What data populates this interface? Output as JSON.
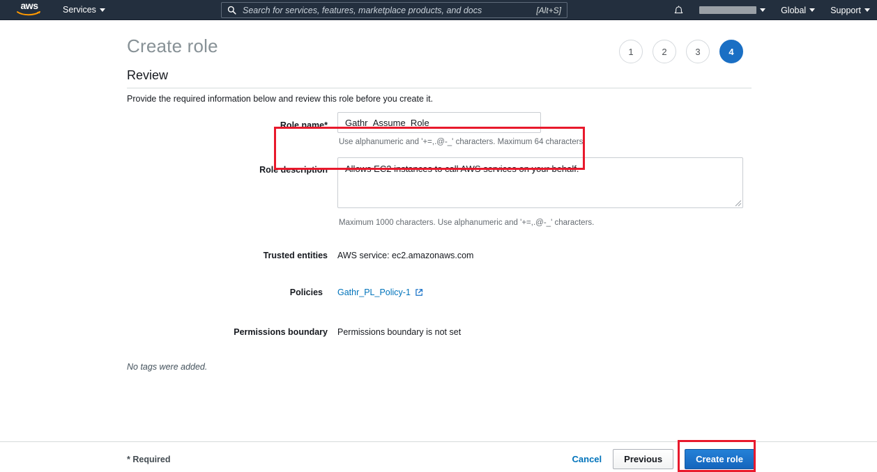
{
  "topnav": {
    "logo_alt": "aws",
    "services_label": "Services",
    "search": {
      "placeholder": "Search for services, features, marketplace products, and docs",
      "value": "",
      "shortcut": "[Alt+S]"
    },
    "account_label": "",
    "region_label": "Global",
    "support_label": "Support"
  },
  "page": {
    "title": "Create role",
    "section_title": "Review",
    "section_description": "Provide the required information below and review this role before you create it.",
    "steps": [
      {
        "label": "1",
        "active": false
      },
      {
        "label": "2",
        "active": false
      },
      {
        "label": "3",
        "active": false
      },
      {
        "label": "4",
        "active": true
      }
    ],
    "fields": {
      "role_name": {
        "label": "Role name*",
        "value": "Gathr_Assume_Role",
        "hint": "Use alphanumeric and '+=,.@-_' characters. Maximum 64 characters."
      },
      "role_description": {
        "label": "Role description",
        "value": "Allows EC2 instances to call AWS services on your behalf.",
        "hint": "Maximum 1000 characters. Use alphanumeric and '+=,.@-_' characters."
      },
      "trusted_entities": {
        "label": "Trusted entities",
        "value": "AWS service: ec2.amazonaws.com"
      },
      "policies": {
        "label": "Policies",
        "value": "Gathr_PL_Policy-1"
      },
      "permissions_boundary": {
        "label": "Permissions boundary",
        "value": "Permissions boundary is not set"
      }
    },
    "tags_note": "No tags were added."
  },
  "footer": {
    "required_note": "* Required",
    "cancel_label": "Cancel",
    "previous_label": "Previous",
    "create_role_label": "Create role"
  },
  "colors": {
    "header_bg": "#232f3e",
    "accent_blue": "#1a6fc4",
    "link_blue": "#0073bb",
    "annotation_red": "#e8192c",
    "logo_orange": "#ff9900"
  }
}
